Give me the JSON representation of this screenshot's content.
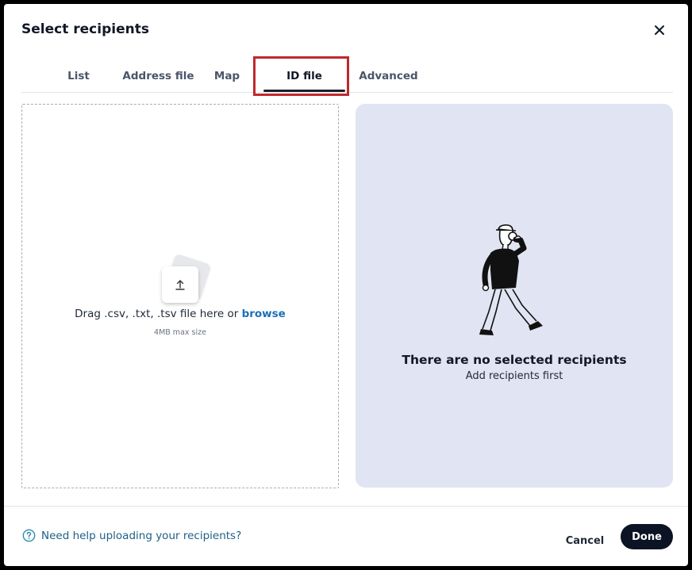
{
  "dialog": {
    "title": "Select recipients"
  },
  "tabs": [
    {
      "label": "List"
    },
    {
      "label": "Address file"
    },
    {
      "label": "Map"
    },
    {
      "label": "ID file",
      "active": true
    },
    {
      "label": "Advanced"
    }
  ],
  "dropzone": {
    "drag_text": "Drag .csv, .txt, .tsv file here or",
    "browse_label": "browse",
    "max_size": "4MB max size",
    "icon": "upload-icon"
  },
  "recipients_panel": {
    "empty_title": "There are no selected recipients",
    "empty_subtitle": "Add recipients first"
  },
  "footer": {
    "help_text": "Need help uploading your recipients?",
    "cancel_label": "Cancel",
    "done_label": "Done"
  },
  "colors": {
    "highlight": "#c0292d",
    "link": "#1d6fb8",
    "panel_bg": "#e1e4f2",
    "primary_button": "#0b1324"
  }
}
